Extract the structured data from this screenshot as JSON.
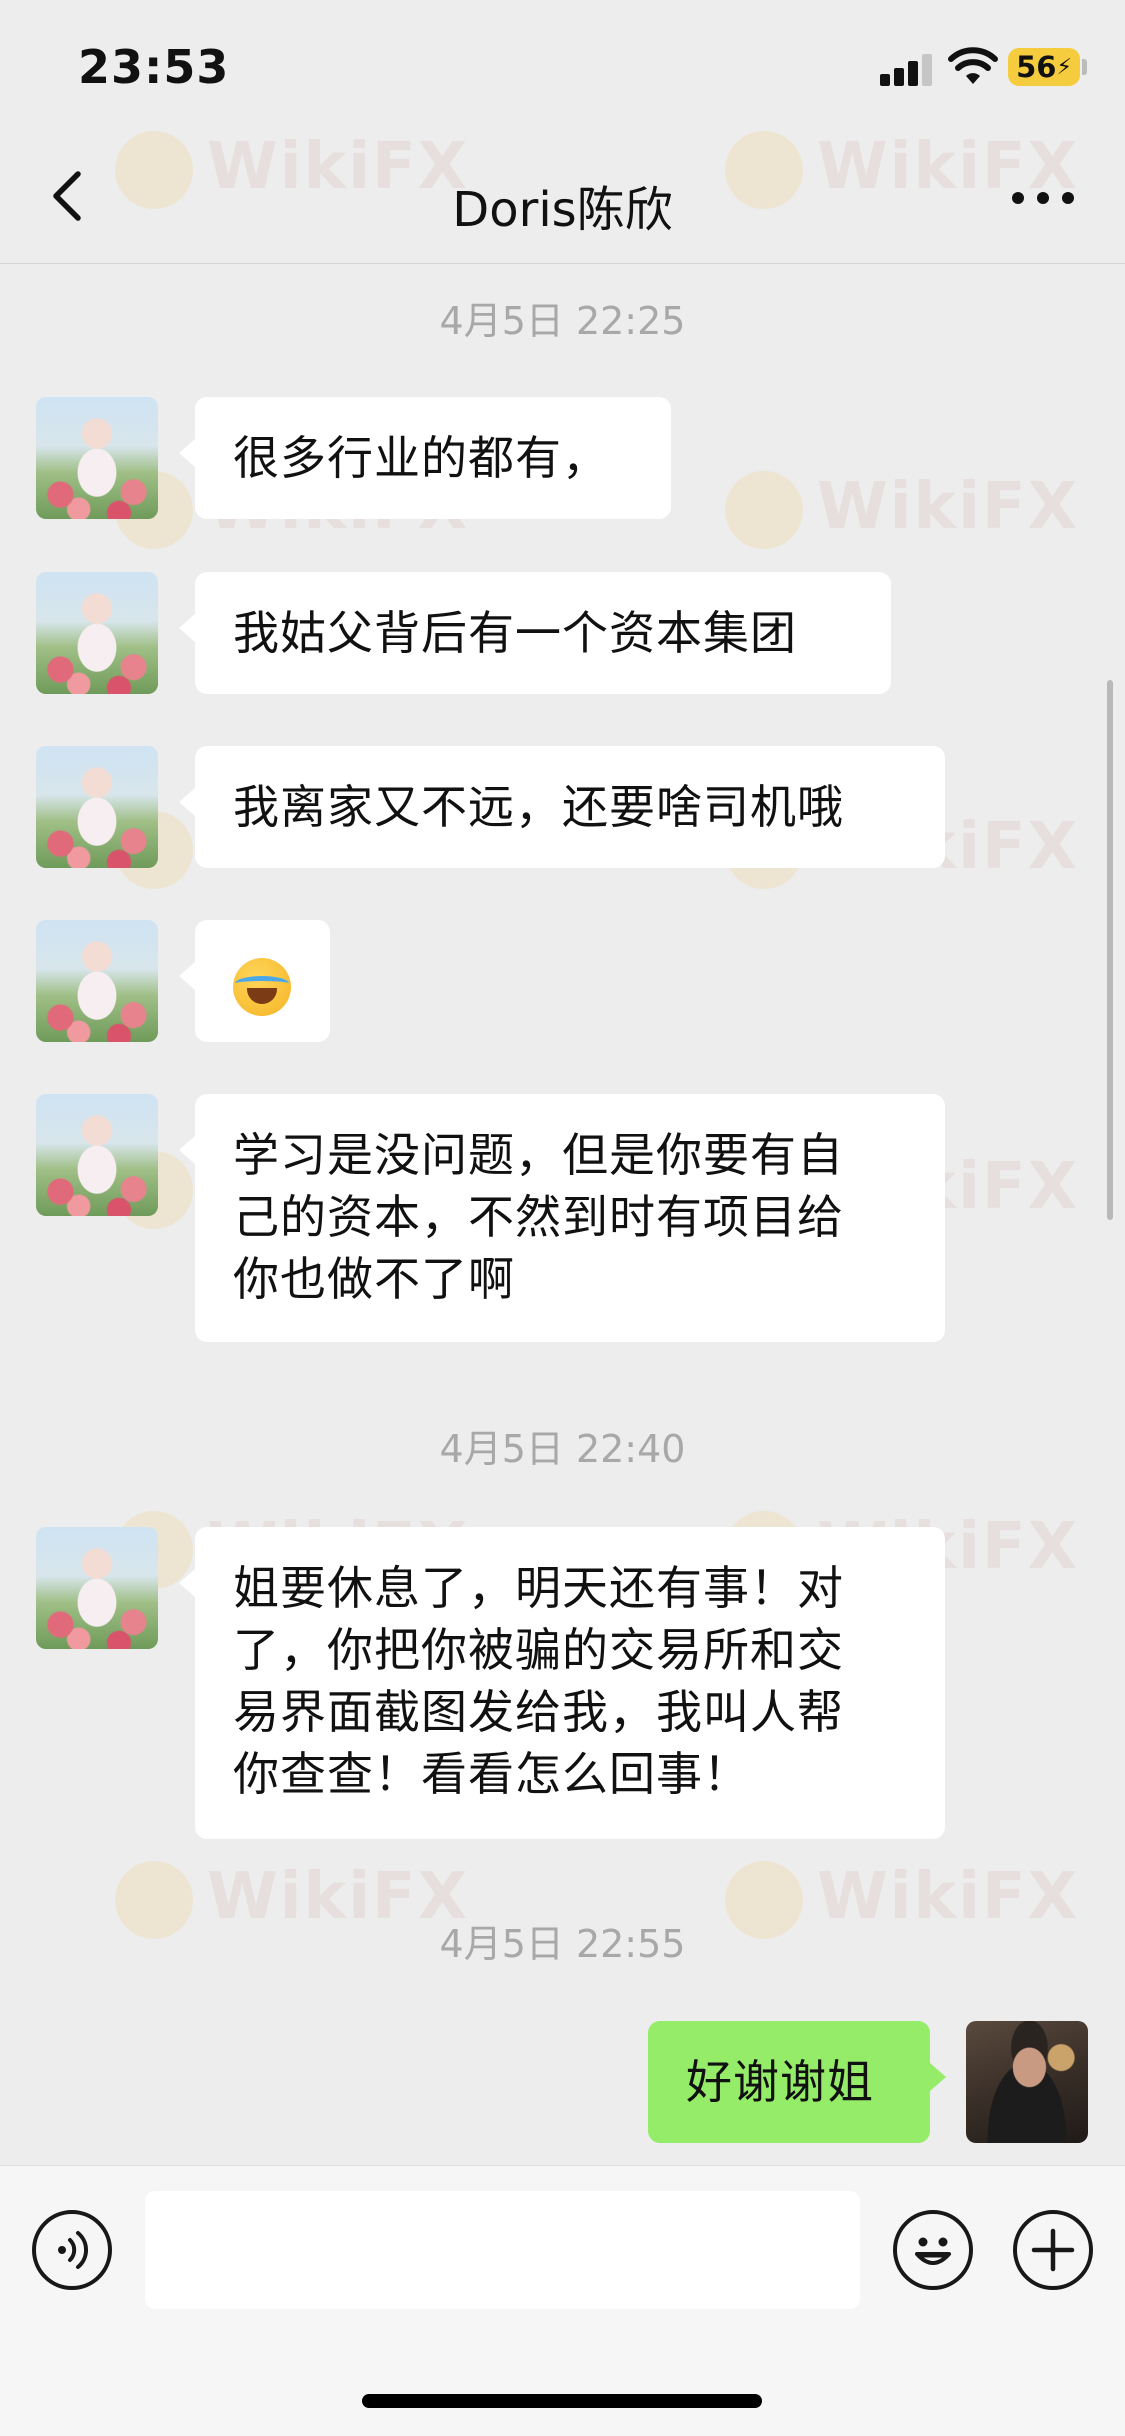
{
  "status_bar": {
    "time": "23:53",
    "battery": "56"
  },
  "nav": {
    "title": "Doris陈欣"
  },
  "watermark": "WikiFX",
  "messages": [
    {
      "type": "timestamp",
      "text": "4月5日 22:25"
    },
    {
      "type": "incoming",
      "text": "很多行业的都有，"
    },
    {
      "type": "incoming",
      "text": "我姑父背后有一个资本集团"
    },
    {
      "type": "incoming",
      "text": "我离家又不远，还要啥司机哦"
    },
    {
      "type": "incoming",
      "text": "",
      "icon": "rolling-laughing-emoji-icon"
    },
    {
      "type": "incoming",
      "lines": [
        "学习是没问题，但是你要有自",
        "己的资本，不然到时有项目给",
        "你也做不了啊"
      ]
    },
    {
      "type": "timestamp",
      "text": "4月5日 22:40"
    },
    {
      "type": "incoming",
      "lines": [
        "姐要休息了，明天还有事！对",
        "了，你把你被骗的交易所和交",
        "易界面截图发给我，我叫人帮",
        "你查查！看看怎么回事！"
      ]
    },
    {
      "type": "timestamp",
      "text": "4月5日 22:55"
    },
    {
      "type": "outgoing",
      "text": "好谢谢姐"
    }
  ],
  "input_bar": {
    "value": "",
    "icons": [
      "voice-icon",
      "emoji-icon",
      "plus-icon"
    ]
  },
  "colors": {
    "background": "#ededed",
    "incoming_bubble": "#ffffff",
    "outgoing_bubble": "#95ec69",
    "timestamp": "#a8a8a8",
    "battery": "#f4cc3d"
  }
}
